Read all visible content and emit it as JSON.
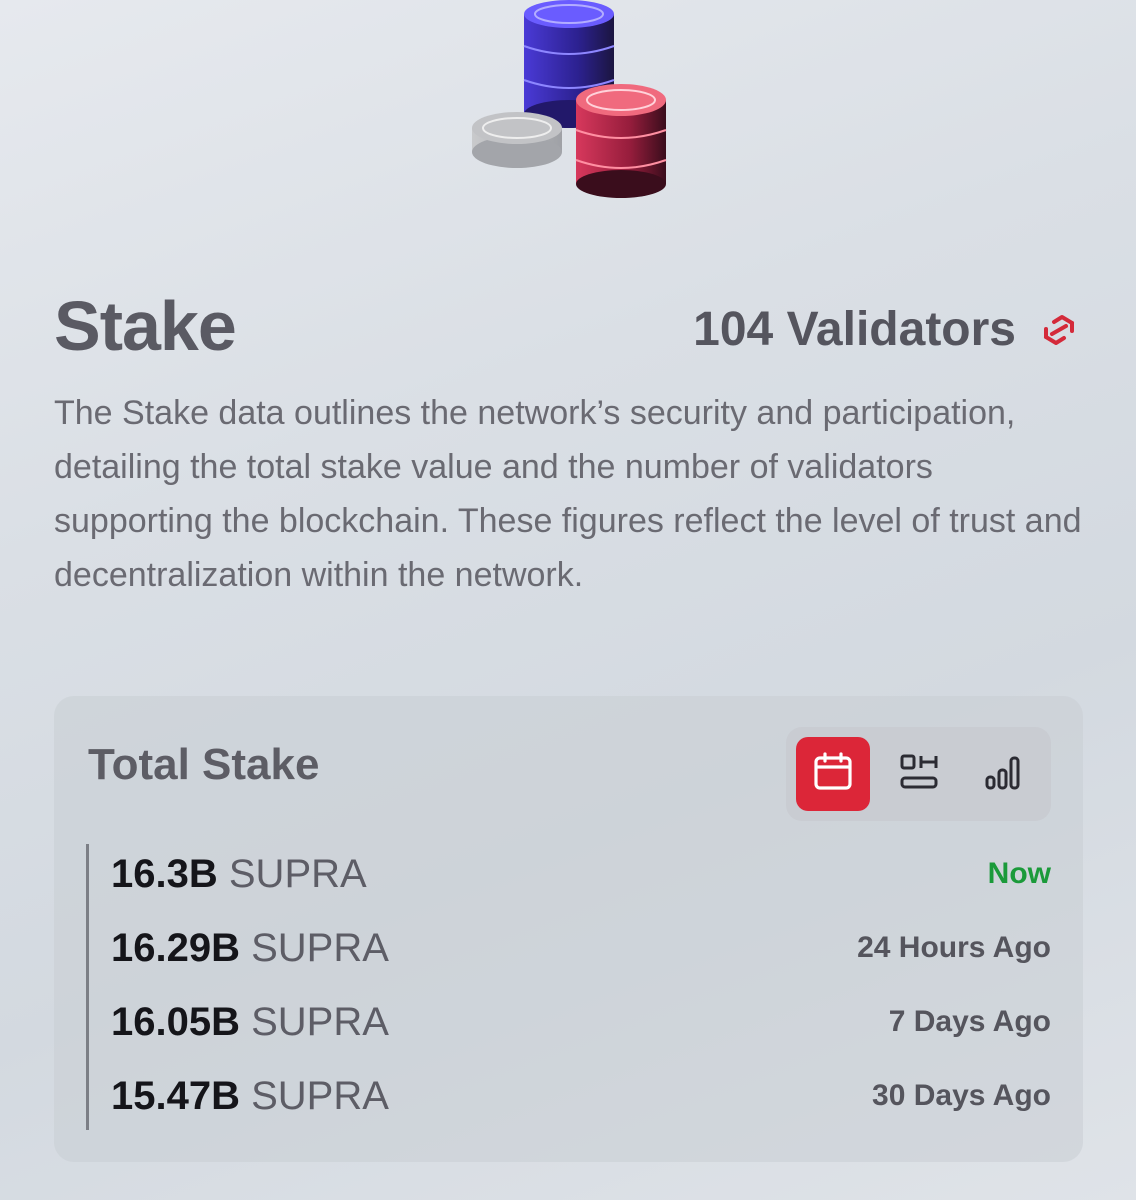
{
  "page": {
    "title": "Stake",
    "validators": "104 Validators",
    "description": "The Stake data outlines the network’s security and participation, detailing the total stake value and the number of validators supporting the blockchain. These figures reflect the level of trust and decentralization within the network."
  },
  "hero": {
    "icon": "coin-stacks-illustration"
  },
  "stake_card": {
    "title": "Total Stake",
    "views": [
      {
        "icon": "calendar-icon",
        "active": true
      },
      {
        "icon": "timeline-icon",
        "active": false
      },
      {
        "icon": "bar-chart-icon",
        "active": false
      }
    ],
    "rows": [
      {
        "amount": "16.3B",
        "unit": "SUPRA",
        "time": "Now"
      },
      {
        "amount": "16.29B",
        "unit": "SUPRA",
        "time": "24 Hours Ago"
      },
      {
        "amount": "16.05B",
        "unit": "SUPRA",
        "time": "7 Days Ago"
      },
      {
        "amount": "15.47B",
        "unit": "SUPRA",
        "time": "30 Days Ago"
      }
    ]
  },
  "colors": {
    "accent": "#dc2638",
    "now_status": "#1b9a3a",
    "title": "#5a5a63",
    "card_bg": "#c8cdd4"
  }
}
